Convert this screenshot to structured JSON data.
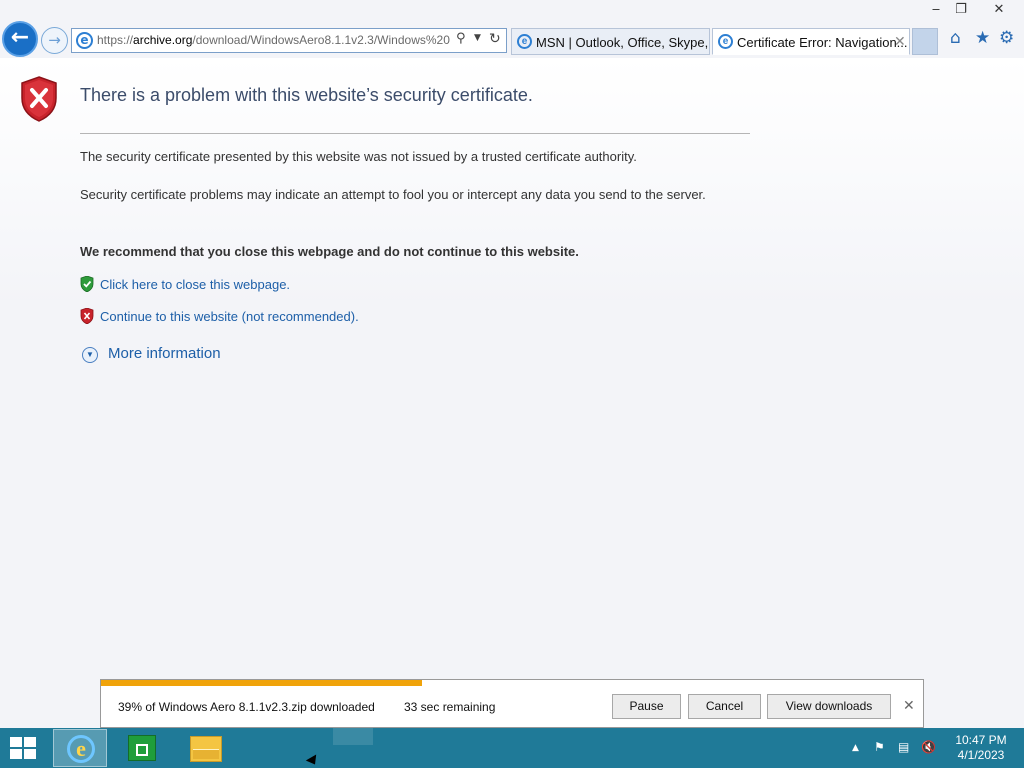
{
  "window": {
    "minimize_glyph": "‒",
    "restore_glyph": "❐",
    "close_glyph": "✕"
  },
  "nav": {
    "back_glyph": "←",
    "forward_glyph": "→"
  },
  "address": {
    "scheme": "https://",
    "host": "archive.org",
    "path": "/download/WindowsAero8.1.1v2.3/Windows%20",
    "search_glyph": "⚲",
    "dropdown_glyph": "▼",
    "refresh_glyph": "↻"
  },
  "tabs": [
    {
      "label": "MSN | Outlook, Office, Skype, ...",
      "icon": "ie-page-icon"
    },
    {
      "label": "Certificate Error: Navigation...",
      "icon": "ie-page-icon",
      "close_glyph": "✕",
      "active": true
    }
  ],
  "toolbar": {
    "home_glyph": "⌂",
    "favorites_glyph": "★",
    "tools_glyph": "⚙"
  },
  "page": {
    "title": "There is a problem with this website’s security certificate.",
    "para1": "The security certificate presented by this website was not issued by a trusted certificate authority.",
    "para2": "Security certificate problems may indicate an attempt to fool you or intercept any data you send to the server.",
    "recommend": "We recommend that you close this webpage and do not continue to this website.",
    "close_link": "Click here to close this webpage.",
    "continue_link": "Continue to this website (not recommended).",
    "more_info": "More information"
  },
  "download": {
    "status": "39% of Windows Aero 8.1.1v2.3.zip downloaded",
    "remaining": "33 sec remaining",
    "progress_fraction": 0.39,
    "pause_label": "Pause",
    "cancel_label": "Cancel",
    "view_label": "View downloads",
    "close_glyph": "✕"
  },
  "taskbar": {
    "ie_glyph": "e",
    "tray_up_glyph": "▲",
    "tray_flag_glyph": "⚑",
    "tray_net_glyph": "▤",
    "tray_vol_glyph": "🔇",
    "time": "10:47 PM",
    "date": "4/1/2023"
  },
  "colors": {
    "accent": "#1a6fc6",
    "link": "#1d5fa8",
    "progress": "#f0a30a",
    "taskbar": "#1f7a98"
  }
}
